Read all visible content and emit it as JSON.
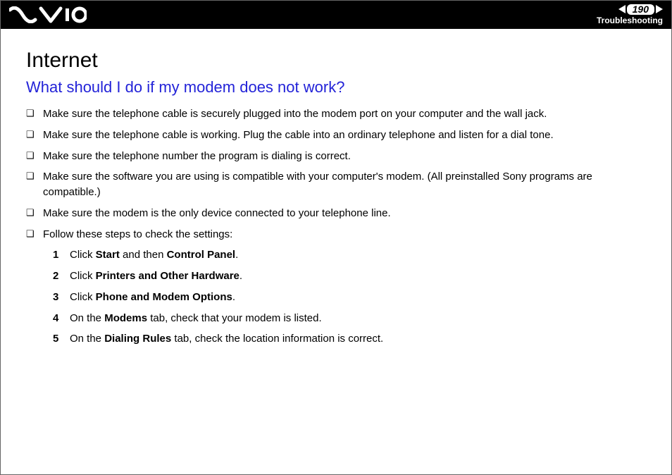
{
  "header": {
    "page_number": "190",
    "section": "Troubleshooting"
  },
  "title": "Internet",
  "question": "What should I do if my modem does not work?",
  "bullets": [
    "Make sure the telephone cable is securely plugged into the modem port on your computer and the wall jack.",
    "Make sure the telephone cable is working. Plug the cable into an ordinary telephone and listen for a dial tone.",
    "Make sure the telephone number the program is dialing is correct.",
    "Make sure the software you are using is compatible with your computer's modem. (All preinstalled Sony programs are compatible.)",
    "Make sure the modem is the only device connected to your telephone line.",
    "Follow these steps to check the settings:"
  ],
  "steps": [
    {
      "pre": "Click ",
      "b1": "Start",
      "mid": " and then ",
      "b2": "Control Panel",
      "post": "."
    },
    {
      "pre": "Click ",
      "b1": "Printers and Other Hardware",
      "mid": "",
      "b2": "",
      "post": "."
    },
    {
      "pre": "Click ",
      "b1": "Phone and Modem Options",
      "mid": "",
      "b2": "",
      "post": "."
    },
    {
      "pre": "On the ",
      "b1": "Modems",
      "mid": " tab, check that your modem is listed.",
      "b2": "",
      "post": ""
    },
    {
      "pre": "On the ",
      "b1": "Dialing Rules",
      "mid": " tab, check the location information is correct.",
      "b2": "",
      "post": ""
    }
  ]
}
